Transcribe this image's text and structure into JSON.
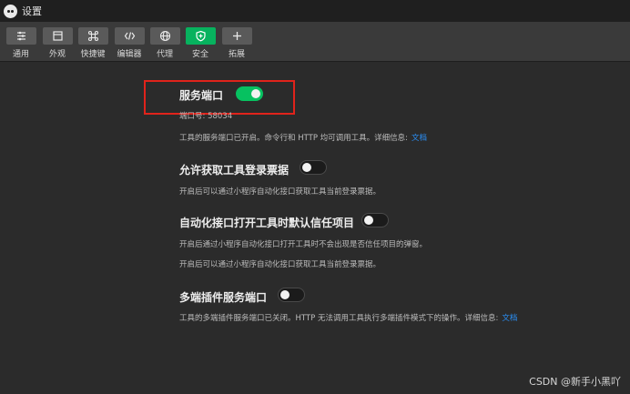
{
  "window": {
    "title": "设置"
  },
  "toolbar": {
    "items": [
      {
        "label": "通用",
        "icon": "sliders-icon"
      },
      {
        "label": "外观",
        "icon": "window-icon"
      },
      {
        "label": "快捷键",
        "icon": "command-icon"
      },
      {
        "label": "编辑器",
        "icon": "code-icon"
      },
      {
        "label": "代理",
        "icon": "globe-icon"
      },
      {
        "label": "安全",
        "icon": "shield-icon",
        "active": true
      },
      {
        "label": "拓展",
        "icon": "plus-icon"
      }
    ]
  },
  "settings": {
    "service_port": {
      "title": "服务端口",
      "enabled": true,
      "port_line": "端口号: 58034",
      "desc": "工具的服务端口已开启。命令行和 HTTP 均可调用工具。详细信息:",
      "link": "文档"
    },
    "login_ticket": {
      "title": "允许获取工具登录票据",
      "enabled": false,
      "desc": "开启后可以通过小程序自动化接口获取工具当前登录票据。"
    },
    "auto_trust": {
      "title": "自动化接口打开工具时默认信任项目",
      "enabled": false,
      "desc1": "开启后通过小程序自动化接口打开工具时不会出现是否信任项目的弹窗。",
      "desc2": "开启后可以通过小程序自动化接口获取工具当前登录票据。"
    },
    "multi_plugin_port": {
      "title": "多端插件服务端口",
      "enabled": false,
      "desc": "工具的多端插件服务端口已关闭。HTTP 无法调用工具执行多端插件模式下的操作。详细信息:",
      "link": "文档"
    }
  },
  "watermark": "CSDN @新手小黑吖",
  "colors": {
    "accent": "#07c160",
    "highlight": "#e0231b",
    "link": "#2a8ef4"
  }
}
